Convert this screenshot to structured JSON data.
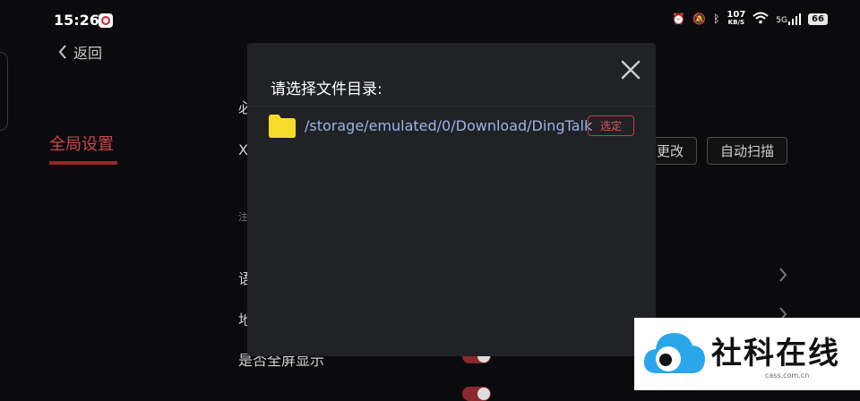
{
  "status_bar": {
    "time": "15:26",
    "net_speed_value": "107",
    "net_speed_unit": "KB/S",
    "signal_label": "5G",
    "battery": "66"
  },
  "nav": {
    "back_label": "返回",
    "global_settings": "全局设置"
  },
  "background": {
    "frag_top": "必",
    "frag_x": "X",
    "change_button": "更改",
    "auto_scan_button": "自动扫描",
    "frag_note": "注",
    "frag_lang": "语",
    "frag_addr": "地",
    "fullscreen_label": "是否全屏显示"
  },
  "dialog": {
    "title": "请选择文件目录:",
    "path": "/storage/emulated/0/Download/DingTalk",
    "select_button": "选定"
  },
  "watermark": {
    "brand": "社科在线",
    "url": "cass.com.cn"
  },
  "colors": {
    "accent": "#c9464c",
    "folder": "#f6dc2a",
    "path_text": "#9cb3e6",
    "dialog_bg": "#202226"
  }
}
